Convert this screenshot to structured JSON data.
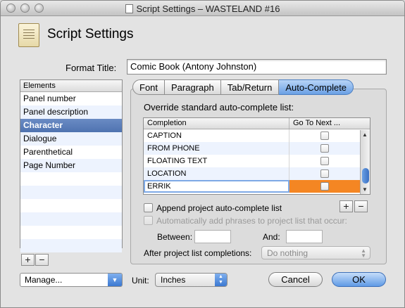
{
  "window": {
    "title": "Script Settings – WASTELAND #16"
  },
  "header": {
    "title": "Script Settings"
  },
  "format": {
    "label": "Format Title:",
    "value": "Comic Book (Antony Johnston)"
  },
  "elements": {
    "header": "Elements",
    "items": [
      "Panel number",
      "Panel description",
      "Character",
      "Dialogue",
      "Parenthetical",
      "Page Number"
    ],
    "selected": "Character"
  },
  "tabs": [
    "Font",
    "Paragraph",
    "Tab/Return",
    "Auto-Complete"
  ],
  "active_tab": "Auto-Complete",
  "autocomplete": {
    "override_label": "Override standard auto-complete list:",
    "columns": [
      "Completion",
      "Go To Next ..."
    ],
    "rows": [
      "CAPTION",
      "FROM PHONE",
      "FLOATING TEXT",
      "LOCATION",
      "ERRIK"
    ],
    "append_label": "Append project auto-complete list",
    "auto_add_label": "Automatically add phrases to project list that occur:",
    "between_label": "Between:",
    "and_label": "And:",
    "after_label": "After project list completions:",
    "after_value": "Do nothing"
  },
  "footer": {
    "manage_label": "Manage...",
    "unit_label": "Unit:",
    "unit_value": "Inches",
    "cancel_label": "Cancel",
    "ok_label": "OK"
  },
  "colors": {
    "accent": "#4f73b0",
    "editing_cell": "#f48623"
  }
}
